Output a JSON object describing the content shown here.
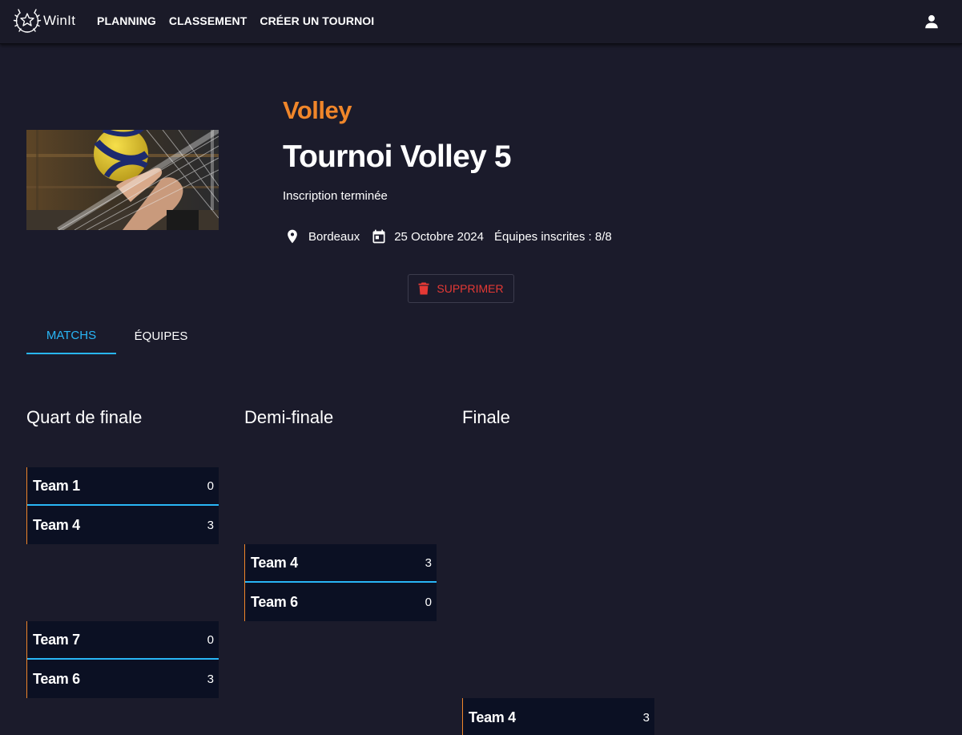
{
  "app": {
    "name": "WinIt"
  },
  "nav": {
    "links": [
      "PLANNING",
      "CLASSEMENT",
      "CRÉER UN TOURNOI"
    ]
  },
  "tournament": {
    "sport": "Volley",
    "title": "Tournoi Volley 5",
    "status": "Inscription terminée",
    "location": "Bordeaux",
    "date": "25 Octobre 2024",
    "teams_registered": "Équipes inscrites : 8/8",
    "delete_label": "SUPPRIMER"
  },
  "tabs": [
    {
      "label": "MATCHS",
      "active": true
    },
    {
      "label": "ÉQUIPES",
      "active": false
    }
  ],
  "bracket": {
    "rounds": [
      {
        "title": "Quart de finale"
      },
      {
        "title": "Demi-finale"
      },
      {
        "title": "Finale"
      }
    ],
    "matches": [
      {
        "round": 0,
        "teams": [
          {
            "name": "Team 1",
            "score": "0"
          },
          {
            "name": "Team 4",
            "score": "3"
          }
        ]
      },
      {
        "round": 0,
        "teams": [
          {
            "name": "Team 7",
            "score": "0"
          },
          {
            "name": "Team 6",
            "score": "3"
          }
        ]
      },
      {
        "round": 1,
        "teams": [
          {
            "name": "Team 4",
            "score": "3"
          },
          {
            "name": "Team 6",
            "score": "0"
          }
        ]
      },
      {
        "round": 2,
        "teams": [
          {
            "name": "Team 4",
            "score": "3"
          }
        ]
      }
    ]
  },
  "colors": {
    "background": "#1b1b2b",
    "navbar": "#1a1a28",
    "accent_orange": "#f0862a",
    "accent_blue": "#29b6f6",
    "danger": "#e53935",
    "match_bg": "#0b1023"
  },
  "icons": {
    "brand": "laurel-star-icon",
    "user": "account-icon",
    "location": "map-pin-icon",
    "date": "calendar-icon",
    "delete": "trash-icon"
  }
}
